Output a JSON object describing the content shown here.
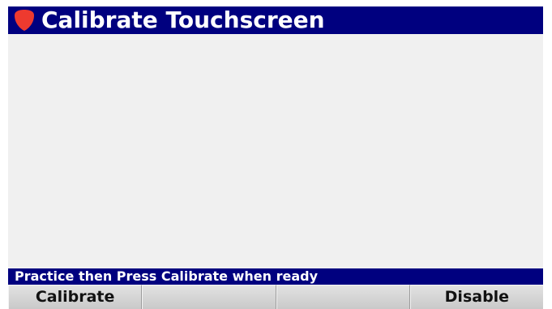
{
  "window": {
    "title": "Calibrate Touchscreen",
    "logo_icon": "red-shield-icon",
    "title_bar_color": "#00007F"
  },
  "status": {
    "message": "Practice then Press Calibrate when ready"
  },
  "softkeys": [
    {
      "label": "Calibrate"
    },
    {
      "label": ""
    },
    {
      "label": ""
    },
    {
      "label": "Disable"
    }
  ],
  "colors": {
    "accent": "#00007F",
    "logo": "#EE3A2F",
    "content_background": "#F0F0F0"
  }
}
